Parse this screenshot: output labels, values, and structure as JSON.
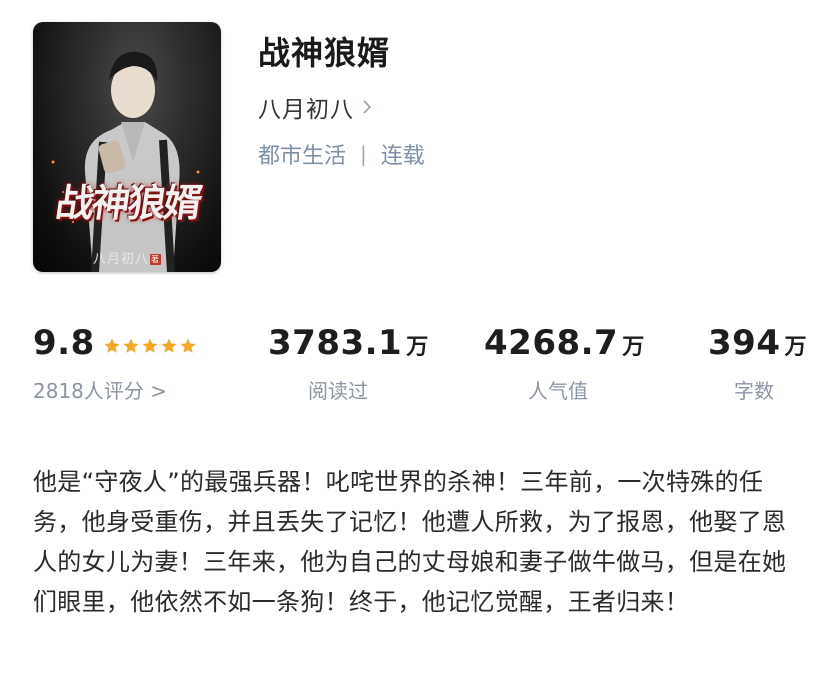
{
  "book": {
    "title": "战神狼婿",
    "author": "八月初八",
    "category": "都市生活",
    "separator": "|",
    "status": "连载"
  },
  "cover": {
    "title_art": "战神狼婿",
    "author_art": "八月初八",
    "seal": "著"
  },
  "stats": {
    "rating": {
      "value": "9.8",
      "stars": 5,
      "label": "2818人评分 >"
    },
    "reads": {
      "value": "3783.1",
      "unit": "万",
      "label": "阅读过"
    },
    "popularity": {
      "value": "4268.7",
      "unit": "万",
      "label": "人气值"
    },
    "words": {
      "value": "394",
      "unit": "万",
      "label": "字数"
    }
  },
  "synopsis": "他是“守夜人”的最强兵器！叱咤世界的杀神！三年前，一次特殊的任务，他身受重伤，并且丢失了记忆！他遭人所救，为了报恩，他娶了恩人的女儿为妻！三年来，他为自己的丈母娘和妻子做牛做马，但是在她们眼里，他依然不如一条狗！终于，他记忆觉醒，王者归来！",
  "colors": {
    "star": "#f5a623",
    "tag": "#7f8fa6",
    "label": "#8c95a3"
  }
}
